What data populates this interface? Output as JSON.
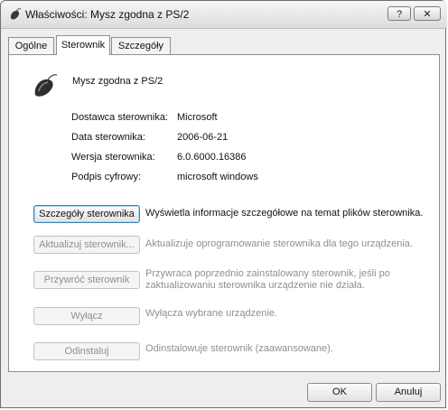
{
  "window": {
    "title": "Właściwości: Mysz zgodna z PS/2",
    "help_label": "?",
    "close_label": "✕"
  },
  "tabs": [
    {
      "label": "Ogólne",
      "active": false
    },
    {
      "label": "Sterownik",
      "active": true
    },
    {
      "label": "Szczegóły",
      "active": false
    }
  ],
  "device": {
    "icon": "mouse-icon",
    "name": "Mysz zgodna z PS/2"
  },
  "properties": [
    {
      "label": "Dostawca sterownika:",
      "value": "Microsoft"
    },
    {
      "label": "Data sterownika:",
      "value": "2006-06-21"
    },
    {
      "label": "Wersja sterownika:",
      "value": "6.0.6000.16386"
    },
    {
      "label": "Podpis cyfrowy:",
      "value": "microsoft windows"
    }
  ],
  "actions": [
    {
      "label": "Szczegóły sterownika",
      "description": "Wyświetla informacje szczegółowe na temat plików sterownika.",
      "enabled": true
    },
    {
      "label": "Aktualizuj sterownik...",
      "description": "Aktualizuje oprogramowanie sterownika dla tego urządzenia.",
      "enabled": false
    },
    {
      "label": "Przywróć sterownik",
      "description": "Przywraca poprzednio zainstalowany sterownik, jeśli po zaktualizowaniu sterownika urządzenie nie działa.",
      "enabled": false
    },
    {
      "label": "Wyłącz",
      "description": "Wyłącza wybrane urządzenie.",
      "enabled": false
    },
    {
      "label": "Odinstaluj",
      "description": "Odinstalowuje sterownik (zaawansowane).",
      "enabled": false
    }
  ],
  "footer": {
    "ok_label": "OK",
    "cancel_label": "Anuluj"
  }
}
